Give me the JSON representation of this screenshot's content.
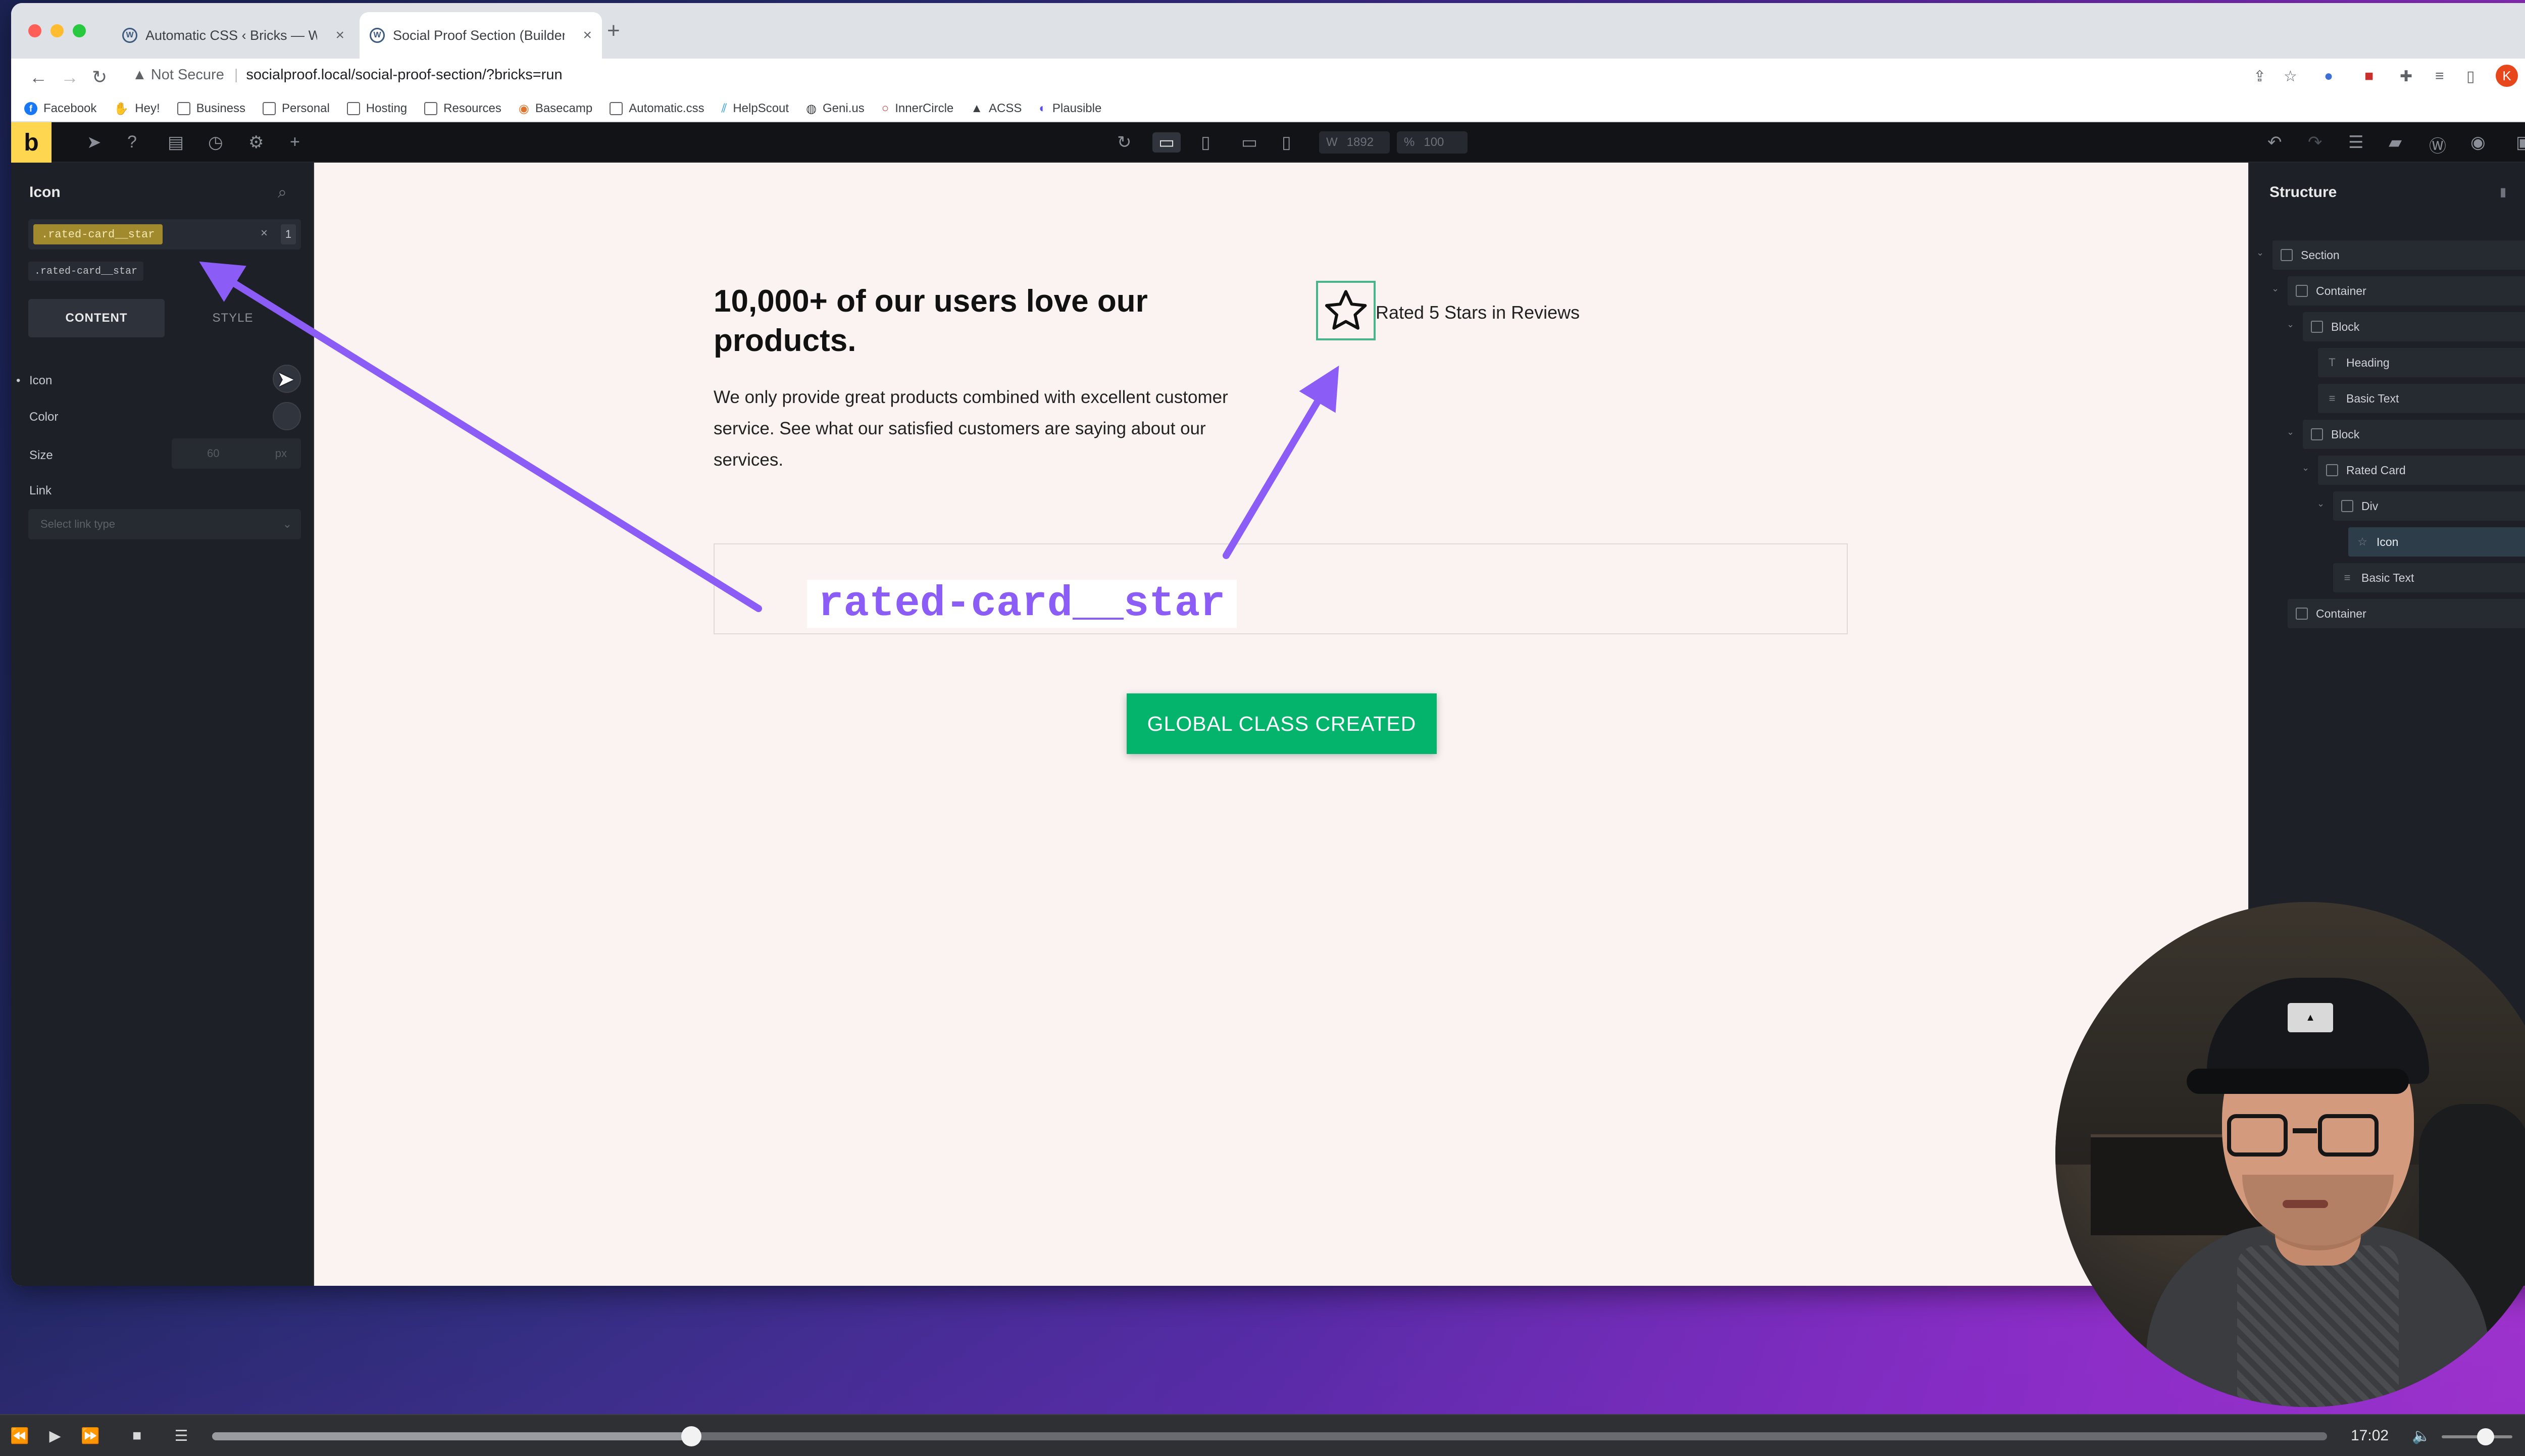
{
  "browser": {
    "tabs": [
      {
        "title": "Automatic CSS ‹ Bricks — Wor",
        "active": false
      },
      {
        "title": "Social Proof Section (Builder)",
        "active": true
      }
    ],
    "security": "Not Secure",
    "url": "socialproof.local/social-proof-section/?bricks=run",
    "profile_initial": "K",
    "bookmarks": [
      "Facebook",
      "Hey!",
      "Business",
      "Personal",
      "Hosting",
      "Resources",
      "Basecamp",
      "Automatic.css",
      "HelpScout",
      "Geni.us",
      "InnerCircle",
      "ACSS",
      "Plausible"
    ]
  },
  "builder": {
    "logo": "b",
    "width_label": "W",
    "width_value": "1892",
    "zoom_label": "%",
    "zoom_value": "100"
  },
  "left_panel": {
    "title": "Icon",
    "active_class": ".rated-card__star",
    "class_count": "1",
    "suggestion": ".rated-card__star",
    "tabs": [
      "CONTENT",
      "STYLE"
    ],
    "controls": {
      "icon": "Icon",
      "color": "Color",
      "size": "Size",
      "size_value": "60",
      "size_unit": "px",
      "link": "Link",
      "link_placeholder": "Select link type"
    }
  },
  "canvas": {
    "heading": "10,000+ of our users love our products.",
    "paragraph": "We only provide great products combined with excellent customer service. See what our satisfied customers are saying about our services.",
    "rated_text": "Rated 5 Stars in Reviews",
    "code_label": "rated-card__star",
    "button": "GLOBAL CLASS CREATED"
  },
  "structure": {
    "title": "Structure",
    "items": [
      {
        "label": "Section",
        "depth": 0
      },
      {
        "label": "Container",
        "depth": 1
      },
      {
        "label": "Block",
        "depth": 2
      },
      {
        "label": "Heading",
        "depth": 3
      },
      {
        "label": "Basic Text",
        "depth": 3
      },
      {
        "label": "Block",
        "depth": 2
      },
      {
        "label": "Rated Card",
        "depth": 3
      },
      {
        "label": "Div",
        "depth": 4
      },
      {
        "label": "Icon",
        "depth": 5,
        "selected": true
      },
      {
        "label": "Basic Text",
        "depth": 4
      },
      {
        "label": "Container",
        "depth": 1
      }
    ]
  },
  "video": {
    "time": "17:02",
    "progress": 0.2266
  },
  "colors": {
    "accent_arrow": "#8b5cf6",
    "button_green": "#04b46d",
    "class_tag": "#a18a2d",
    "bricks_yellow": "#ffd64f"
  }
}
